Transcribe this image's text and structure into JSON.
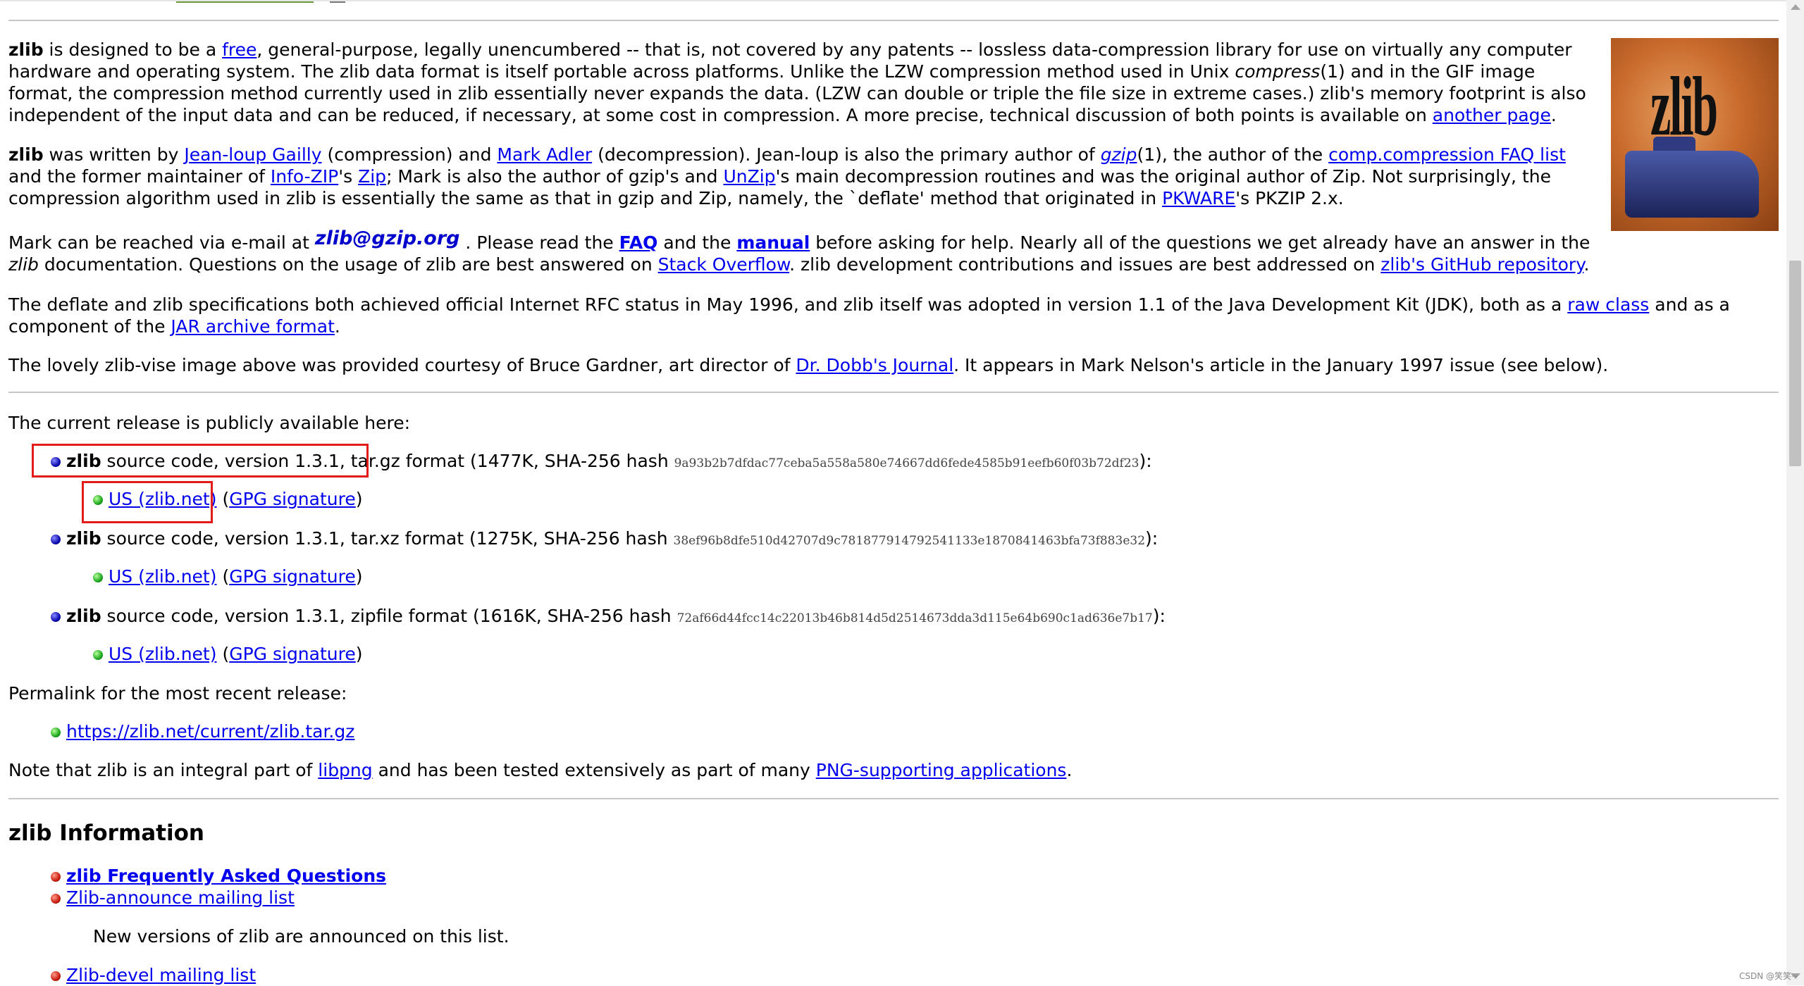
{
  "intro": {
    "p1": {
      "zlib": "zlib",
      "t1": " is designed to be a ",
      "free": "free",
      "t2": ", general-purpose, legally unencumbered -- that is, not covered by any patents -- lossless data-compression library for use on virtually any computer hardware and operating system. The zlib data format is itself portable across platforms. Unlike the LZW compression method used in Unix ",
      "compress": "compress",
      "t3": "(1) and in the GIF image format, the compression method currently used in zlib essentially never expands the data. (LZW can double or triple the file size in extreme cases.) zlib's memory footprint is also independent of the input data and can be reduced, if necessary, at some cost in compression. A more precise, technical discussion of both points is available on ",
      "another_page": "another page",
      "t4": "."
    },
    "p2": {
      "zlib": "zlib",
      "t1": " was written by ",
      "gailly": "Jean-loup Gailly",
      "t2": " (compression) and ",
      "adler": "Mark Adler",
      "t3": " (decompression). Jean-loup is also the primary author of ",
      "gzip": "gzip",
      "t4": "(1), the author of the ",
      "faq_list": "comp.compression FAQ list",
      "t5": " and the former maintainer of ",
      "infozip": "Info-ZIP",
      "t6": "'s ",
      "zip": "Zip",
      "t7": "; Mark is also the author of gzip's and ",
      "unzip": "UnZip",
      "t8": "'s main decompression routines and was the original author of Zip. Not surprisingly, the compression algorithm used in zlib is essentially the same as that in gzip and Zip, namely, the `deflate' method that originated in ",
      "pkware": "PKWARE",
      "t9": "'s PKZIP 2.x."
    },
    "p3": {
      "t1": "Mark can be reached via e-mail at ",
      "email": "zlib@gzip.org",
      "t2": " . Please read the ",
      "faq": "FAQ",
      "t3": " and the ",
      "manual": "manual",
      "t4": " before asking for help. Nearly all of the questions we get already have an answer in the ",
      "zlib_i": "zlib",
      "t5": " documentation. Questions on the usage of zlib are best answered on ",
      "stackoverflow": "Stack Overflow",
      "t6": ". zlib development contributions and issues are best addressed on ",
      "github": "zlib's GitHub repository",
      "t7": "."
    },
    "p4": {
      "t1": "The deflate and zlib specifications both achieved official Internet RFC status in May 1996, and zlib itself was adopted in version 1.1 of the Java Development Kit (JDK), both as a ",
      "raw_class": "raw class",
      "t2": " and as a component of the ",
      "jar": "JAR archive format",
      "t3": "."
    },
    "p5": {
      "t1": "The lovely zlib-vise image above was provided courtesy of Bruce Gardner, art director of ",
      "ddj": "Dr. Dobb's Journal",
      "t2": ". It appears in Mark Nelson's article in the January 1997 issue (see below)."
    }
  },
  "logo": {
    "text": "zlib"
  },
  "release": {
    "intro": "The current release is publicly available here:",
    "items": [
      {
        "name": "zlib",
        "desc": " source code, version 1.3.1, tar.gz format (1477K, SHA-256 hash ",
        "hash": "9a93b2b7dfdac77ceba5a558a580e74667dd6fede4585b91eefb60f03b72df23",
        "end": "):",
        "mirror": "US (zlib.net)",
        "sig": "GPG signature"
      },
      {
        "name": "zlib",
        "desc": " source code, version 1.3.1, tar.xz format (1275K, SHA-256 hash ",
        "hash": "38ef96b8dfe510d42707d9c781877914792541133e1870841463bfa73f883e32",
        "end": "):",
        "mirror": "US (zlib.net)",
        "sig": "GPG signature"
      },
      {
        "name": "zlib",
        "desc": " source code, version 1.3.1, zipfile format (1616K, SHA-256 hash ",
        "hash": "72af66d44fcc14c22013b46b814d5d2514673dda3d115e64b690c1ad636e7b17",
        "end": "):",
        "mirror": "US (zlib.net)",
        "sig": "GPG signature"
      }
    ],
    "open_paren": "(",
    "close_paren": ")",
    "space": " "
  },
  "permalink": {
    "label": "Permalink for the most recent release:",
    "url": "https://zlib.net/current/zlib.tar.gz"
  },
  "note": {
    "t1": "Note that zlib is an integral part of ",
    "libpng": "libpng",
    "t2": " and has been tested extensively as part of many ",
    "png_apps": "PNG-supporting applications",
    "t3": "."
  },
  "info": {
    "heading": "zlib Information",
    "faq": "zlib Frequently Asked Questions",
    "announce": "Zlib-announce mailing list",
    "announce_desc": "New versions of zlib are announced on this list.",
    "devel": "Zlib-devel mailing list"
  },
  "watermark": "CSDN @笑笑~",
  "colors": {
    "link": "#0000ee",
    "highlight": "#e21b1b"
  },
  "icons": [
    "blue-bullet-icon",
    "green-bullet-icon",
    "red-bullet-icon",
    "zlib-vise-logo"
  ]
}
